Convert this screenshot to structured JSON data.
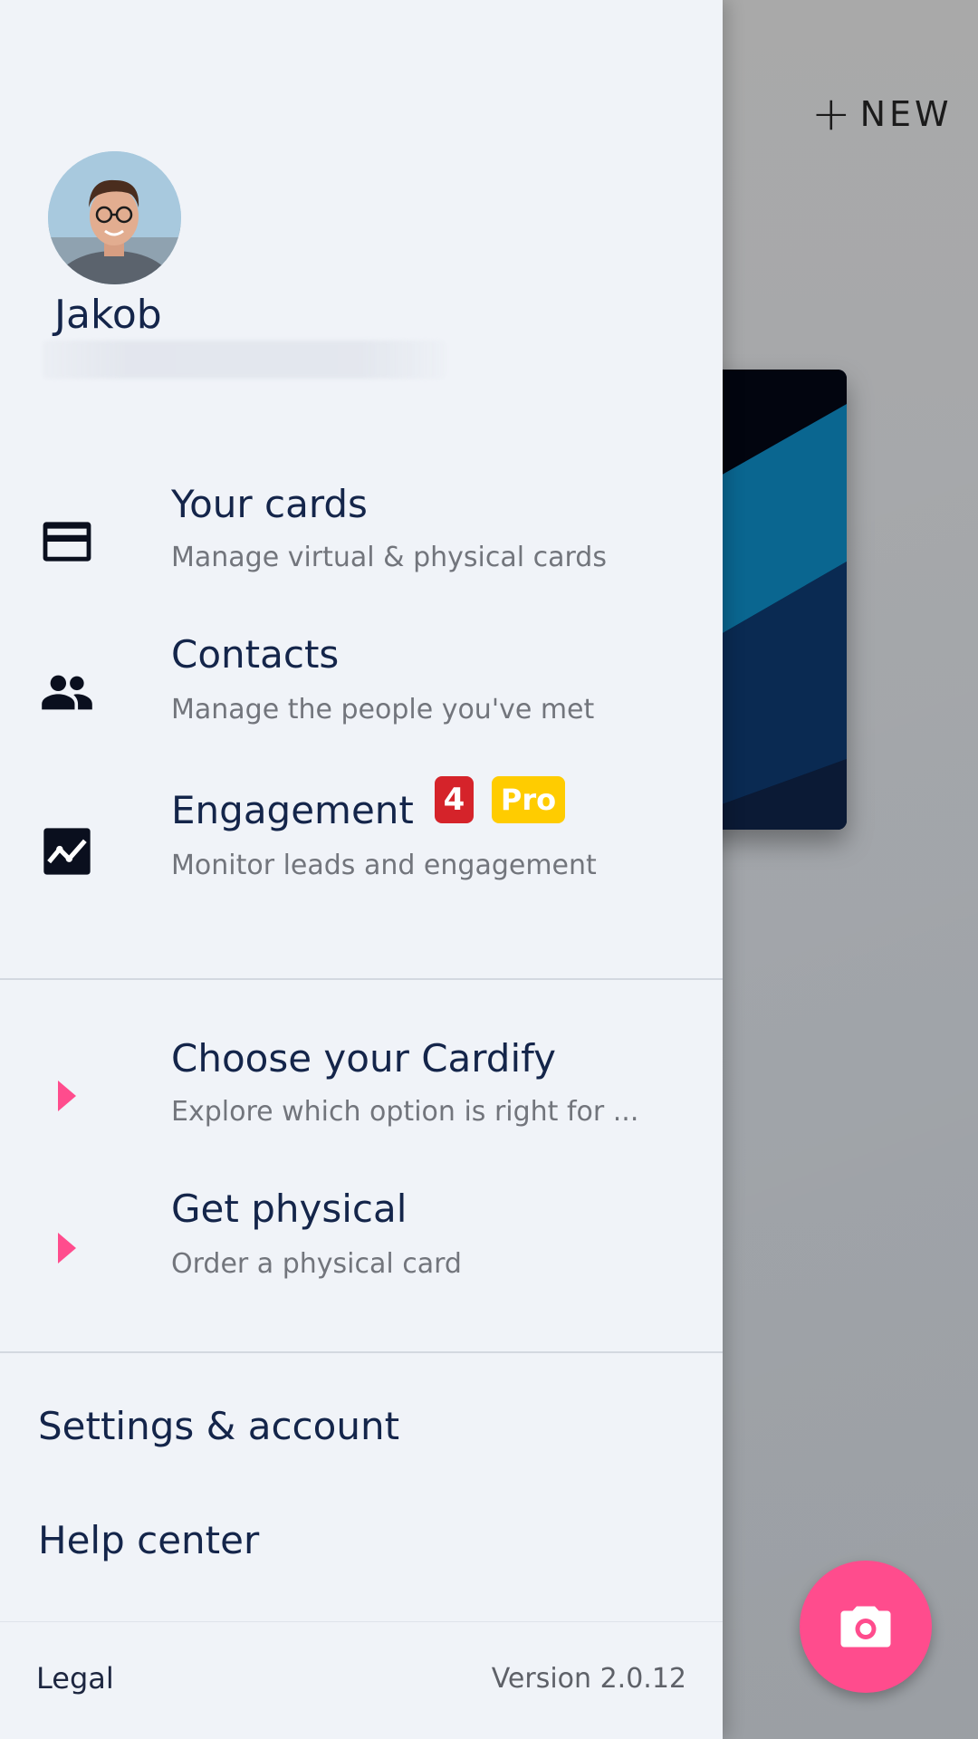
{
  "background": {
    "new_button": {
      "label": "NEW"
    }
  },
  "drawer": {
    "user": {
      "name": "Jakob"
    },
    "primary_items": [
      {
        "title": "Your cards",
        "subtitle": "Manage virtual & physical cards",
        "icon": "credit-card-icon"
      },
      {
        "title": "Contacts",
        "subtitle": "Manage the people you've met",
        "icon": "people-icon"
      },
      {
        "title": "Engagement",
        "subtitle": "Monitor leads and engagement",
        "icon": "chart-line-icon",
        "badge_count": "4",
        "badge_pro": "Pro"
      }
    ],
    "secondary_items": [
      {
        "title": "Choose your Cardify",
        "subtitle": "Explore which option is right for ...",
        "icon": "play-arrow-icon"
      },
      {
        "title": "Get physical",
        "subtitle": "Order a physical card",
        "icon": "play-arrow-icon"
      }
    ],
    "links": {
      "settings": "Settings & account",
      "help": "Help center"
    },
    "footer": {
      "legal": "Legal",
      "version": "Version 2.0.12"
    }
  },
  "colors": {
    "drawer_bg": "#f0f3f8",
    "text_primary": "#14254a",
    "text_secondary": "#72757c",
    "accent_pink": "#ff4c8d",
    "badge_red": "#d5232a",
    "badge_yellow": "#ffcc00"
  }
}
